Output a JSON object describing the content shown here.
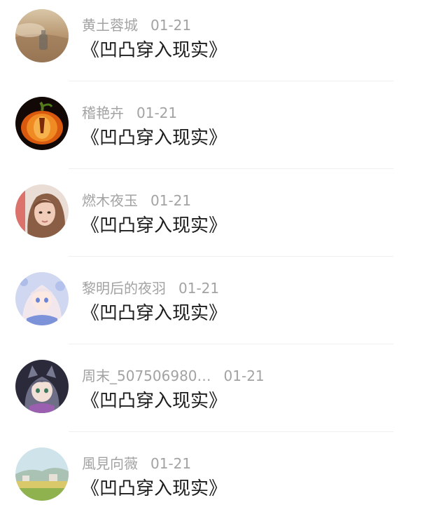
{
  "comments": [
    {
      "name": "黄土蓉城",
      "time": "01-21",
      "text": "《凹凸穿入现实》",
      "avatar_icon": "beach-bottle-avatar"
    },
    {
      "name": "稽艳卉",
      "time": "01-21",
      "text": "《凹凸穿入现实》",
      "avatar_icon": "pumpkin-avatar"
    },
    {
      "name": "燃木夜玉",
      "time": "01-21",
      "text": "《凹凸穿入现实》",
      "avatar_icon": "girl-photo-avatar"
    },
    {
      "name": "黎明后的夜羽",
      "time": "01-21",
      "text": "《凹凸穿入现实》",
      "avatar_icon": "anime-girl-avatar"
    },
    {
      "name": "周末_507506980…",
      "time": "01-21",
      "text": "《凹凸穿入现实》",
      "avatar_icon": "anime-catboy-avatar"
    },
    {
      "name": "風見向薇",
      "time": "01-21",
      "text": "《凹凸穿入现实》",
      "avatar_icon": "landscape-avatar"
    }
  ]
}
